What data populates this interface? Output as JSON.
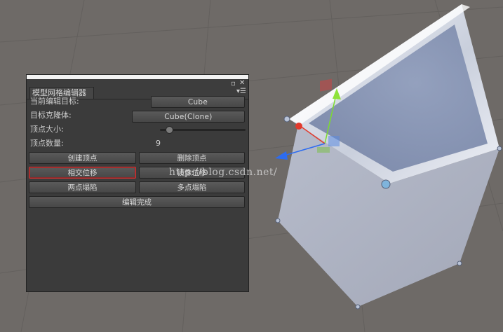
{
  "window": {
    "tab_title": "模型网格编辑器"
  },
  "fields": {
    "target_label": "当前编辑目标:",
    "target_value": "Cube",
    "clone_label": "目标克隆体:",
    "clone_value": "Cube(Clone)",
    "vertex_size_label": "顶点大小:",
    "vertex_count_label": "顶点数量:",
    "vertex_count_value": "9"
  },
  "vertex_size_slider": {
    "value": 0.07
  },
  "buttons": {
    "create_vertex": "创建顶点",
    "delete_vertex": "删除顶点",
    "intersect_move": "相交位移",
    "mirror_move": "镜像位移",
    "two_point_collapse": "两点塌陷",
    "multi_point_collapse": "多点塌陷",
    "finish_edit": "编辑完成"
  },
  "icons": {
    "maximize": "maximize-icon",
    "close": "close-icon",
    "menu": "menu-icon"
  },
  "watermark": "http://blog.csdn.net/",
  "colors": {
    "scene_bg": "#6e6a67",
    "panel_bg": "#3b3b3b",
    "active_outline": "#d03434",
    "gizmo_y": "#7cdc2e",
    "gizmo_x": "#e23a2c",
    "gizmo_z": "#2d6cf0"
  }
}
